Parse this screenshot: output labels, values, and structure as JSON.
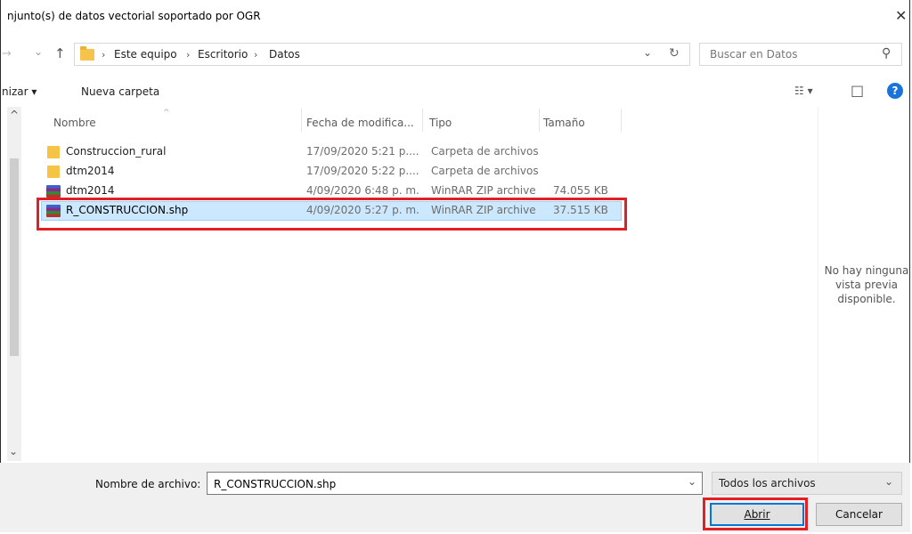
{
  "window": {
    "title": "njunto(s) de datos vectorial soportado por OGR",
    "close_glyph": "✕"
  },
  "nav": {
    "back_glyph": "→",
    "recent_glyph": "⌄",
    "up_glyph": "↑",
    "breadcrumb": [
      "Este equipo",
      "Escritorio",
      "Datos"
    ],
    "breadcrumb_sep": "›",
    "dropdown_glyph": "⌄",
    "refresh_glyph": "↻",
    "search_placeholder": "Buscar en Datos",
    "search_glyph": "⚲"
  },
  "toolbar": {
    "organize_label": "nizar ▾",
    "new_folder_label": "Nueva carpeta",
    "view_glyph": "☷ ▾",
    "preview_glyph": "□",
    "help_glyph": "?"
  },
  "columns": {
    "name": "Nombre",
    "date": "Fecha de modifica...",
    "type": "Tipo",
    "size": "Tamaño",
    "sort_glyph": "^"
  },
  "files": [
    {
      "name": "Construccion_rural",
      "date": "17/09/2020 5:21 p....",
      "type": "Carpeta de archivos",
      "size": "",
      "icon": "folder-icon"
    },
    {
      "name": "dtm2014",
      "date": "17/09/2020 5:22 p....",
      "type": "Carpeta de archivos",
      "size": "",
      "icon": "folder-icon"
    },
    {
      "name": "dtm2014",
      "date": "4/09/2020 6:48 p. m.",
      "type": "WinRAR ZIP archive",
      "size": "74.055 KB",
      "icon": "zip-archive-icon"
    },
    {
      "name": "R_CONSTRUCCION.shp",
      "date": "4/09/2020 5:27 p. m.",
      "type": "WinRAR ZIP archive",
      "size": "37.515 KB",
      "icon": "zip-archive-icon"
    }
  ],
  "scroll": {
    "up_glyph": "^",
    "down_glyph": "⌄"
  },
  "preview": {
    "message": "No hay ninguna vista previa disponible."
  },
  "footer": {
    "filename_label": "Nombre de archivo:",
    "filename_value": "R_CONSTRUCCION.shp",
    "filename_dropdown_glyph": "⌄",
    "filter_value": "Todos los archivos",
    "filter_dropdown_glyph": "⌄",
    "open_label": "Abrir",
    "cancel_label": "Cancelar"
  },
  "colors": {
    "highlight_border": "#e31e24",
    "selection_fill": "#cce8ff",
    "accent_blue": "#0078d7"
  }
}
